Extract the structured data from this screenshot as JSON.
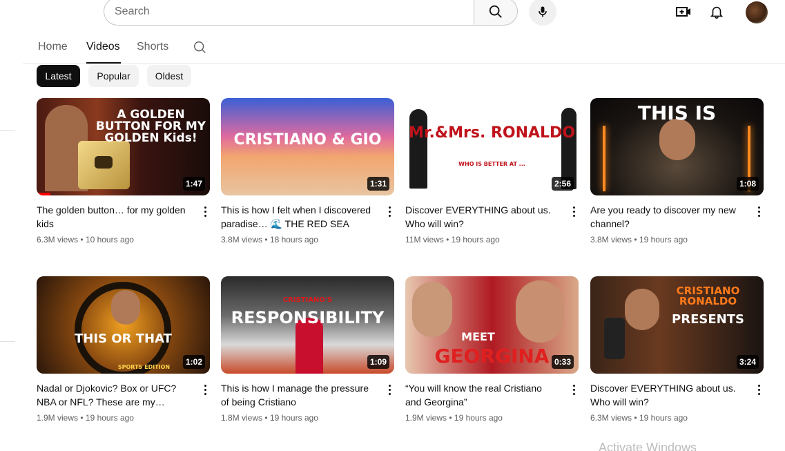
{
  "search": {
    "placeholder": "Search"
  },
  "tabs": [
    {
      "label": "Home"
    },
    {
      "label": "Videos"
    },
    {
      "label": "Shorts"
    }
  ],
  "chips": [
    {
      "label": "Latest"
    },
    {
      "label": "Popular"
    },
    {
      "label": "Oldest"
    }
  ],
  "videos": [
    {
      "title": "The golden button… for my golden kids",
      "views": "6.3M views",
      "age": "10 hours ago",
      "duration": "1:47",
      "thumb_text": "A GOLDEN BUTTON FOR MY GOLDEN Kids!",
      "watch_progress": 0.08
    },
    {
      "title": "This is how I felt when I discovered paradise… 🌊 THE RED SEA Projec…",
      "views": "3.8M views",
      "age": "18 hours ago",
      "duration": "1:31",
      "thumb_text": "CRISTIANO & GIO"
    },
    {
      "title": "Discover EVERYTHING about us. Who will win?",
      "views": "11M views",
      "age": "19 hours ago",
      "duration": "2:56",
      "thumb_text": "Mr.&Mrs. RONALDO",
      "thumb_sub": "WHO IS BETTER AT ..."
    },
    {
      "title": "Are you ready to discover my new channel?",
      "views": "3.8M views",
      "age": "19 hours ago",
      "duration": "1:08",
      "thumb_text": "THIS IS"
    },
    {
      "title": "Nadal or Djokovic? Box or UFC? NBA or NFL? These are my…",
      "views": "1.9M views",
      "age": "19 hours ago",
      "duration": "1:02",
      "thumb_text": "THIS OR THAT",
      "thumb_sub": "SPORTS EDITION"
    },
    {
      "title": "This is how I manage the pressure of being Cristiano",
      "views": "1.8M views",
      "age": "19 hours ago",
      "duration": "1:09",
      "thumb_text": "RESPONSIBILITY",
      "thumb_sub": "CRISTIANO'S"
    },
    {
      "title": "“You will know the real Cristiano and Georgina”",
      "views": "1.9M views",
      "age": "19 hours ago",
      "duration": "0:33",
      "thumb_text": "GEORGINA",
      "thumb_sub": "MEET"
    },
    {
      "title": "Discover EVERYTHING about us. Who will win?",
      "views": "6.3M views",
      "age": "19 hours ago",
      "duration": "3:24",
      "thumb_text": "CRISTIANO RONALDO",
      "thumb_sub": "PRESENTS"
    }
  ],
  "watermark": "Activate Windows",
  "colors": {
    "accent": "#ff0000",
    "active_chip": "#0f0f0f",
    "chip_bg": "#f2f2f2",
    "meta_text": "#606060"
  },
  "icons": [
    "search-icon",
    "mic-icon",
    "create-icon",
    "bell-icon",
    "more-vert-icon"
  ]
}
